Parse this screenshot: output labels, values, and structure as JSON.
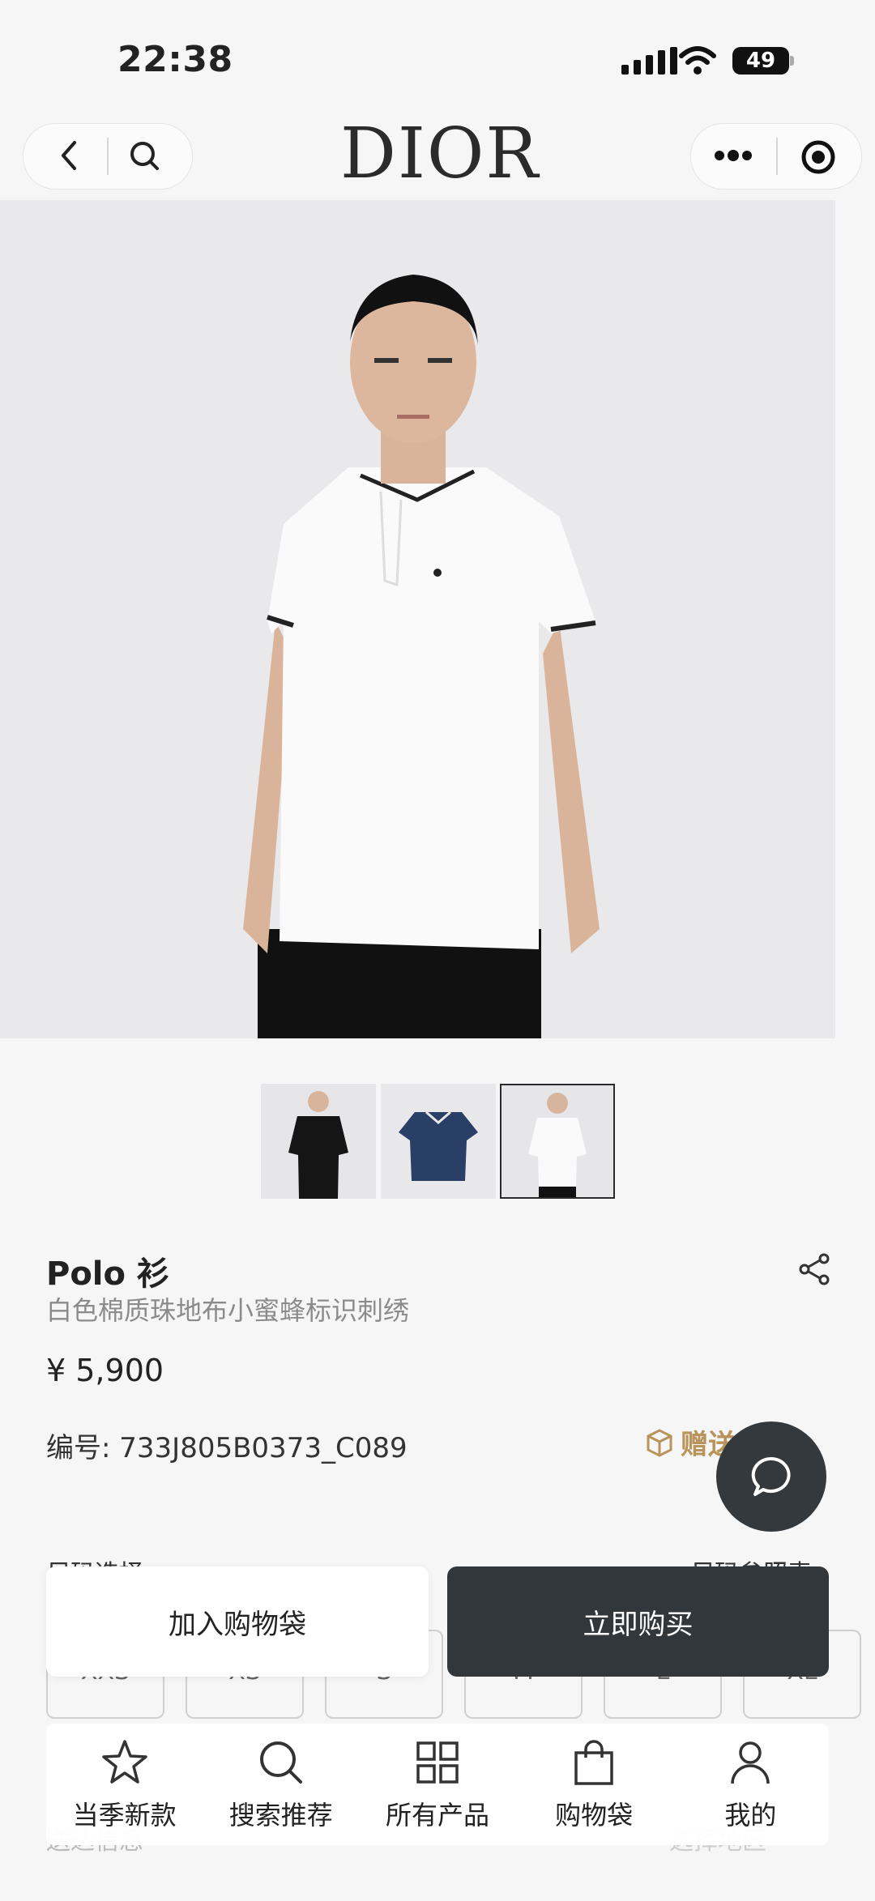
{
  "status_bar": {
    "time": "22:38",
    "battery": "49"
  },
  "header": {
    "brand": "DIOR"
  },
  "thumbnails": [
    {
      "name": "black-polo"
    },
    {
      "name": "navy-polo"
    },
    {
      "name": "white-polo",
      "selected": true
    }
  ],
  "product": {
    "name": "Polo 衫",
    "subtitle": "白色棉质珠地布小蜜蜂标识刺绣",
    "price": "¥ 5,900",
    "code_label": "编号:",
    "code_value": "733J805B0373_C089",
    "gift_label": "赠送"
  },
  "size": {
    "title": "尺码选择",
    "chart_link": "尺码参照表",
    "options": [
      "XXS",
      "XS",
      "S",
      "M",
      "L",
      "XL"
    ]
  },
  "actions": {
    "add_to_cart": "加入购物袋",
    "buy_now": "立即购买"
  },
  "delivery": {
    "label": "送达信息",
    "region_placeholder": "选择地区"
  },
  "tabbar": [
    {
      "label": "当季新款",
      "icon": "star-icon"
    },
    {
      "label": "搜索推荐",
      "icon": "search-icon"
    },
    {
      "label": "所有产品",
      "icon": "grid-icon"
    },
    {
      "label": "购物袋",
      "icon": "bag-icon"
    },
    {
      "label": "我的",
      "icon": "user-icon"
    }
  ],
  "colors": {
    "accent_dark": "#32373b",
    "gift_gold": "#b8935a"
  }
}
